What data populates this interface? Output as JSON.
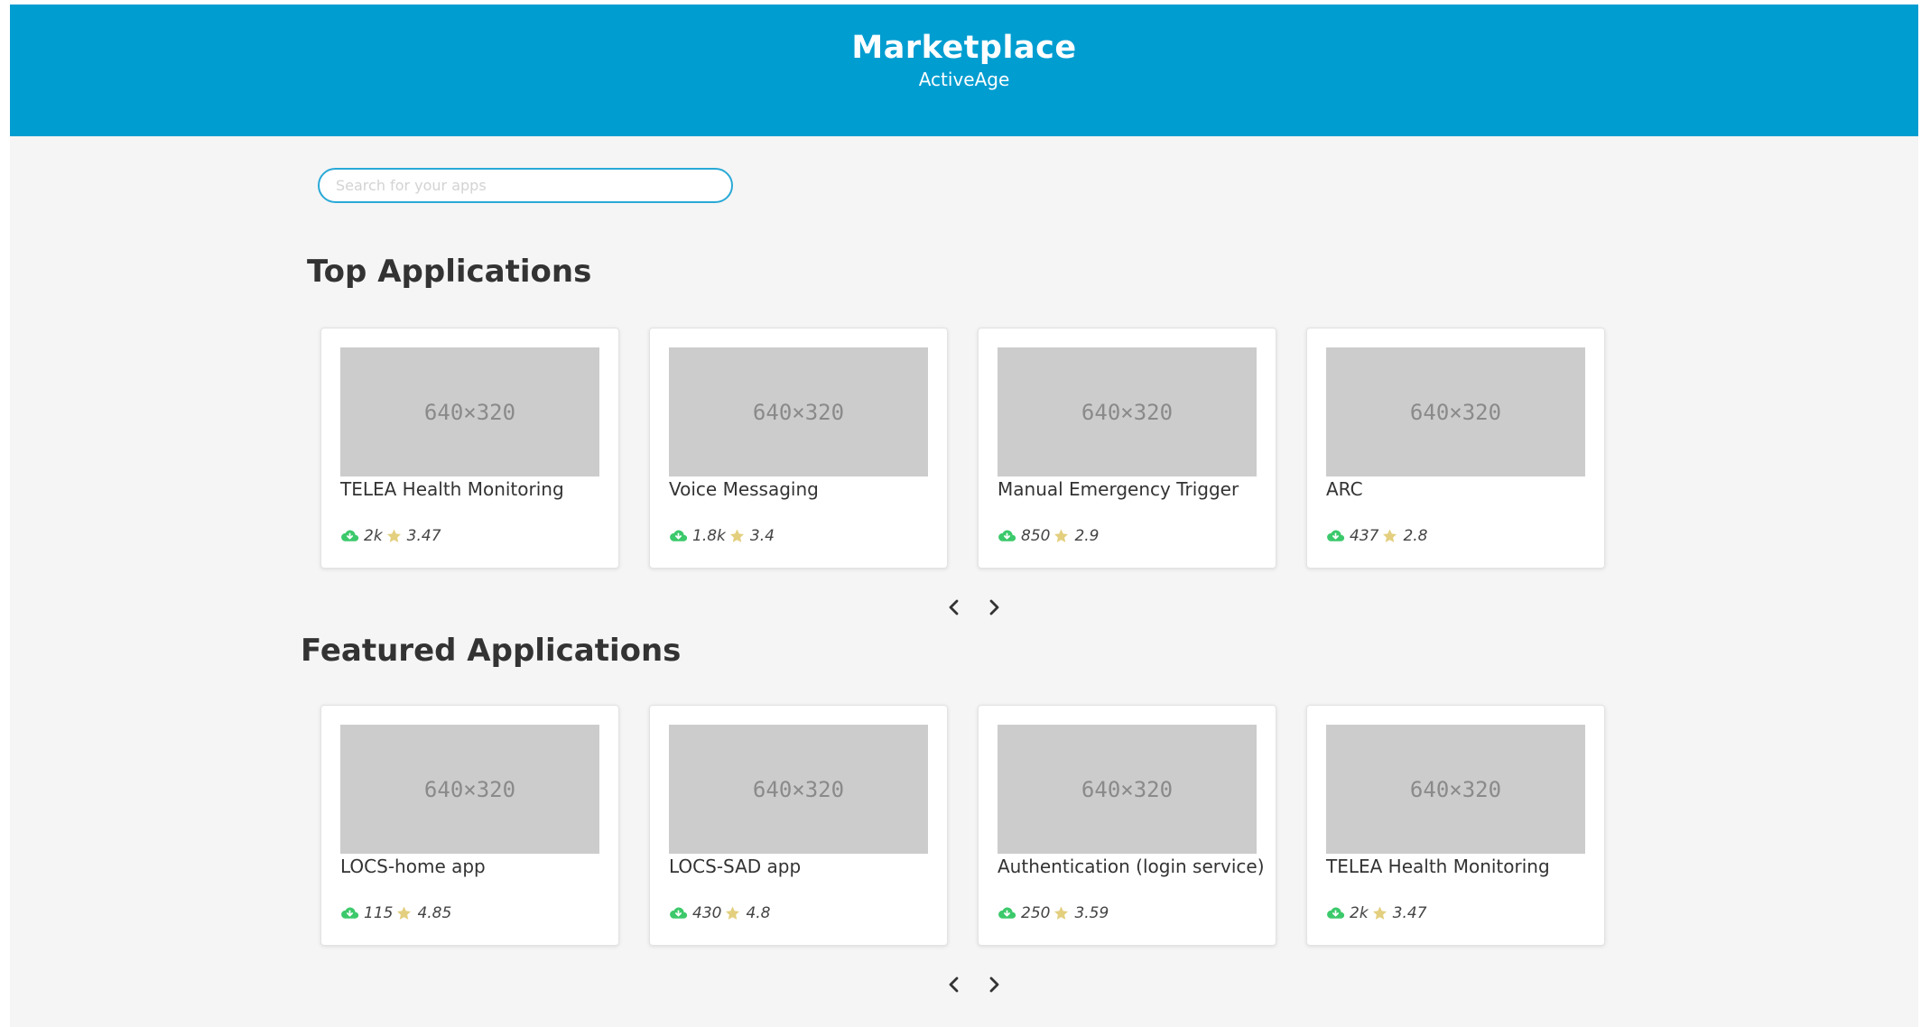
{
  "header": {
    "title": "Marketplace",
    "subtitle": "ActiveAge"
  },
  "search": {
    "placeholder": "Search for your apps",
    "value": ""
  },
  "colors": {
    "header_bg": "#009dd1",
    "download_icon": "#3cc96b",
    "star_icon": "#e3cf7e",
    "search_border": "#29a9d6"
  },
  "sections": [
    {
      "title": "Top Applications",
      "cards": [
        {
          "image_label": "640×320",
          "name": "TELEA Health Monitoring",
          "downloads": "2k",
          "rating": "3.47"
        },
        {
          "image_label": "640×320",
          "name": "Voice Messaging",
          "downloads": "1.8k",
          "rating": "3.4"
        },
        {
          "image_label": "640×320",
          "name": "Manual Emergency Trigger",
          "downloads": "850",
          "rating": "2.9"
        },
        {
          "image_label": "640×320",
          "name": "ARC",
          "downloads": "437",
          "rating": "2.8"
        }
      ],
      "pager": {
        "prev_icon": "chevron-left-icon",
        "next_icon": "chevron-right-icon"
      }
    },
    {
      "title": "Featured Applications",
      "cards": [
        {
          "image_label": "640×320",
          "name": "LOCS-home app",
          "downloads": "115",
          "rating": "4.85"
        },
        {
          "image_label": "640×320",
          "name": "LOCS-SAD app",
          "downloads": "430",
          "rating": "4.8"
        },
        {
          "image_label": "640×320",
          "name": "Authentication (login service)",
          "downloads": "250",
          "rating": "3.59"
        },
        {
          "image_label": "640×320",
          "name": "TELEA Health Monitoring",
          "downloads": "2k",
          "rating": "3.47"
        }
      ],
      "pager": {
        "prev_icon": "chevron-left-icon",
        "next_icon": "chevron-right-icon"
      }
    }
  ]
}
